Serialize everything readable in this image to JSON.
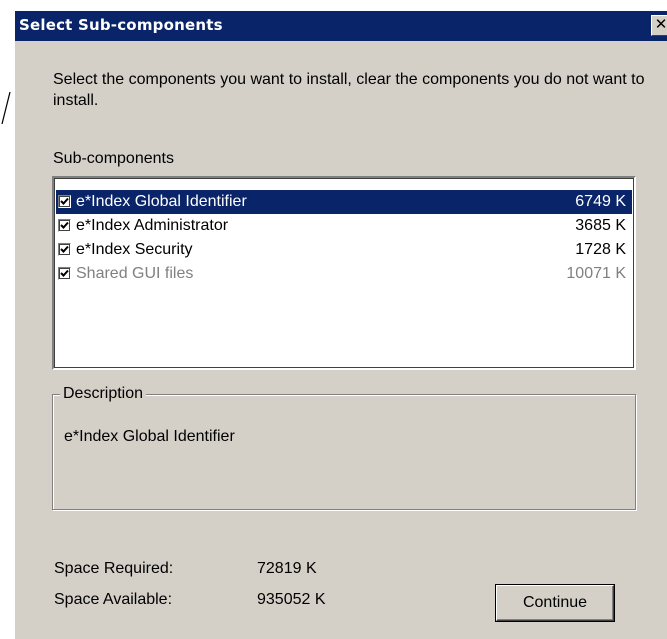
{
  "window": {
    "title": "Select Sub-components"
  },
  "instructions": "Select the components you want to install, clear the components you do not want to install.",
  "subcomponents_label": "Sub-components",
  "components": [
    {
      "name": "e*Index Global Identifier",
      "size": "6749 K",
      "checked": true,
      "selected": true,
      "disabled": false
    },
    {
      "name": "e*Index Administrator",
      "size": "3685 K",
      "checked": true,
      "selected": false,
      "disabled": false
    },
    {
      "name": "e*Index Security",
      "size": "1728 K",
      "checked": true,
      "selected": false,
      "disabled": false
    },
    {
      "name": "Shared GUI files",
      "size": "10071 K",
      "checked": true,
      "selected": false,
      "disabled": true
    }
  ],
  "description": {
    "label": "Description",
    "text": "e*Index Global Identifier"
  },
  "space": {
    "required_label": "Space Required:",
    "required_value": "72819 K",
    "available_label": "Space Available:",
    "available_value": "935052 K"
  },
  "buttons": {
    "continue_label": "Continue",
    "close_glyph": "✕"
  },
  "colors": {
    "titlebar": "#0a246a",
    "selection": "#0a246a",
    "face": "#d4d0c8",
    "disabled_text": "#808080"
  }
}
